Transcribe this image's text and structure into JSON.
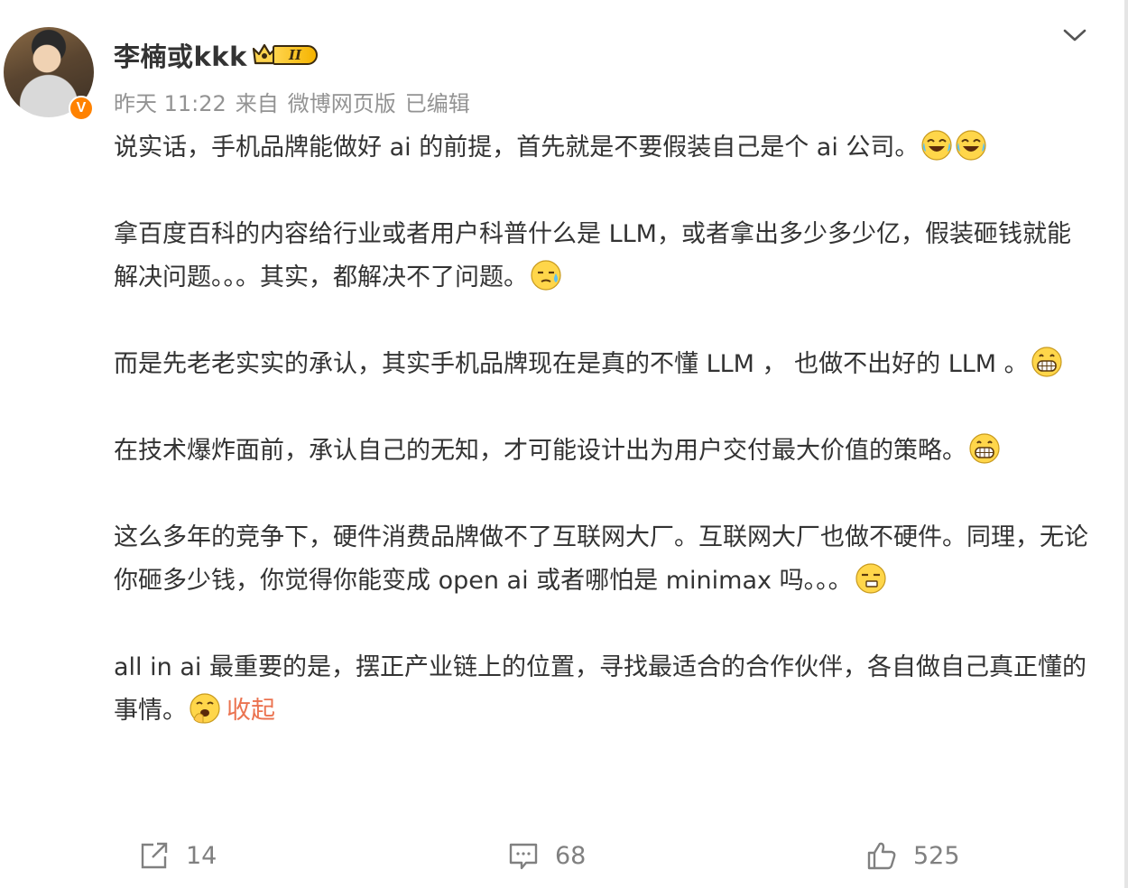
{
  "post": {
    "author": "李楠或kkk",
    "level_badge": "II",
    "verified_badge": "V",
    "time": "昨天 11:22",
    "source_prefix": "来自",
    "source": "微博网页版",
    "edited": "已编辑"
  },
  "content": {
    "p1": "说实话，手机品牌能做好 ai 的前提，首先就是不要假装自己是个 ai 公司。",
    "p2": "拿百度百科的内容给行业或者用户科普什么是 LLM，或者拿出多少多少亿，假装砸钱就能解决问题。。。其实，都解决不了问题。",
    "p3": "而是先老老实实的承认，其实手机品牌现在是真的不懂 LLM ， 也做不出好的 LLM 。",
    "p4": "在技术爆炸面前，承认自己的无知，才可能设计出为用户交付最大价值的策略。",
    "p5": "这么多年的竞争下，硬件消费品牌做不了互联网大厂。互联网大厂也做不硬件。同理，无论你砸多少钱，你觉得你能变成 open ai 或者哪怕是 minimax 吗。。。",
    "p6": "all in ai 最重要的是，摆正产业链上的位置，寻找最适合的合作伙伴，各自做自己真正懂的事情。",
    "collapse": "收起"
  },
  "actions": {
    "repost_count": "14",
    "comment_count": "68",
    "like_count": "525"
  },
  "colors": {
    "link": "#eb7350",
    "meta": "#939393",
    "verified": "#ff8200",
    "text": "#333333"
  },
  "icons": [
    "chevron-down-icon",
    "laughing-tears-emoji",
    "sweat-emoji",
    "grin-emoji",
    "smirk-emoji",
    "shush-emoji",
    "repost-icon",
    "comment-icon",
    "like-icon"
  ]
}
